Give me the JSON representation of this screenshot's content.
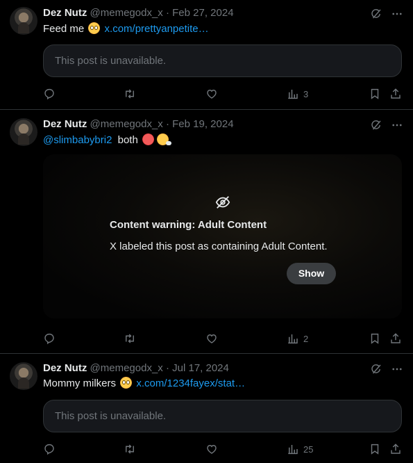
{
  "colors": {
    "background": "#000000",
    "text": "#e7e9ea",
    "muted": "#71767b",
    "link": "#1d9bf0",
    "border": "#2f3336"
  },
  "tweets": [
    {
      "name": "Dez Nutz",
      "handle": "@memegodx_x",
      "dot": "·",
      "date": "Feb 27, 2024",
      "text": "Feed me",
      "emoji": "pleading-face",
      "link": "x.com/prettyanpetite…",
      "unavailable": "This post is unavailable.",
      "views": "3"
    },
    {
      "name": "Dez Nutz",
      "handle": "@memegodx_x",
      "dot": "·",
      "date": "Feb 19, 2024",
      "mention": "@slimbabybri2",
      "text": "both",
      "emoji": [
        "hot-face",
        "face-with-steam"
      ],
      "content_warning": {
        "title": "Content warning: Adult Content",
        "description": "X labeled this post as containing Adult Content.",
        "show_label": "Show"
      },
      "views": "2"
    },
    {
      "name": "Dez Nutz",
      "handle": "@memegodx_x",
      "dot": "·",
      "date": "Jul 17, 2024",
      "text": "Mommy milkers",
      "emoji": "pleading-face",
      "link": "x.com/1234fayex/stat…",
      "unavailable": "This post is unavailable.",
      "views": "25"
    }
  ],
  "icons": {
    "grok": "grok-icon",
    "more": "more-icon",
    "reply": "reply-icon",
    "repost": "repost-icon",
    "like": "like-icon",
    "views": "views-icon",
    "bookmark": "bookmark-icon",
    "share": "share-icon",
    "hidden": "eye-slash-icon"
  }
}
